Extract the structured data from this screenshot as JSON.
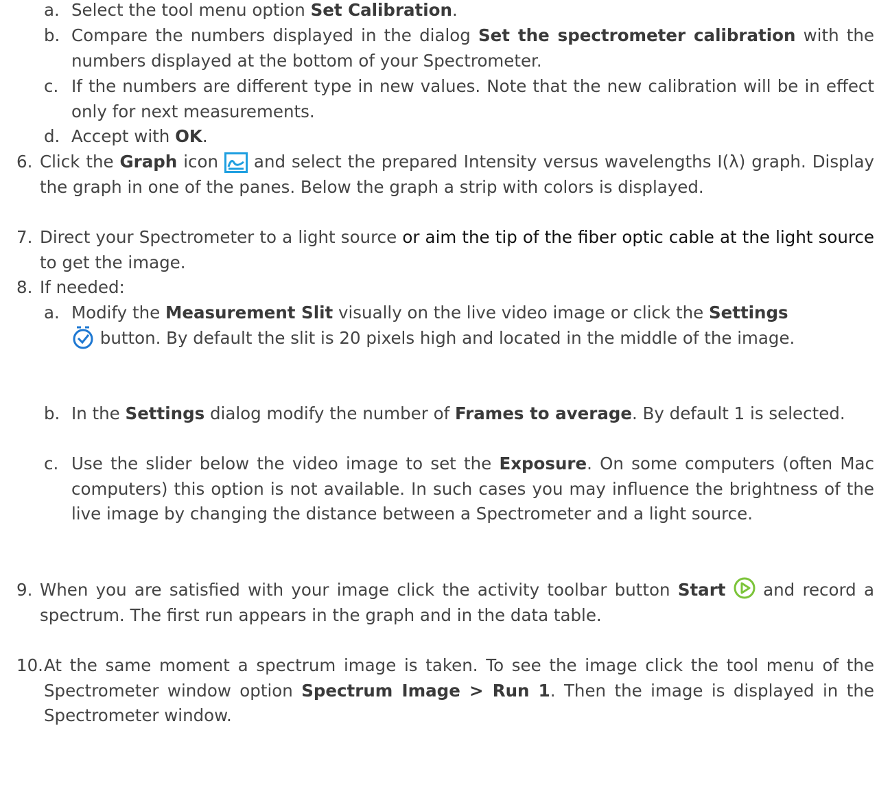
{
  "colors": {
    "text": "#444444",
    "graph_icon": "#1e9fe0",
    "settings_icon": "#1e78d2",
    "start_icon": "#7cc43a"
  },
  "steps": {
    "s5a": {
      "label": "a.",
      "t1": "Select the tool menu option ",
      "b1": "Set Calibration",
      "t2": "."
    },
    "s5b": {
      "label": "b.",
      "t1": "Compare the numbers displayed in the dialog ",
      "b1": "Set the spectrometer calibration",
      "t2": " with the numbers displayed at the bottom of your Spectrometer."
    },
    "s5c": {
      "label": "c.",
      "t1": "If the numbers are different type in new values. Note that the new calibration will be in effect only for next measurements."
    },
    "s5d": {
      "label": "d.",
      "t1": "Accept with ",
      "b1": "OK",
      "t2": "."
    },
    "s6": {
      "label": "6.",
      "t1": "Click the ",
      "b1": "Graph",
      "t2": " icon",
      "icon": "graph-icon",
      "t3": " and select the prepared Intensity versus wavelengths I(λ) graph. Display the graph in one of the panes. Below the graph a strip with colors is displayed."
    },
    "s7": {
      "label": "7.",
      "t1": "Direct your Spectrometer to a light source ",
      "t2": "or aim the tip of the fiber optic cable at the light source",
      "t3": " to get the image."
    },
    "s8": {
      "label": "8.",
      "t1": "If needed:"
    },
    "s8a": {
      "label": "a.",
      "t1": "Modify the ",
      "b1": "Measurement Slit",
      "t2": " visually on the live video image or click the ",
      "b2": "Settings",
      "icon": "stopwatch-icon",
      "t3": " button. By default the slit is 20 pixels high and located in the middle of the image."
    },
    "s8b": {
      "label": "b.",
      "t1": "In the ",
      "b1": "Settings",
      "t2": " dialog modify the number of ",
      "b2": "Frames to average",
      "t3": ". By default 1 is selected."
    },
    "s8c": {
      "label": "c.",
      "t1": "Use the slider below the video image to set the ",
      "b1": "Exposure",
      "t2": ". On some computers (often Mac computers) this option is not available. In such cases you may influence the brightness of the live image by changing the distance between a Spectrometer and a light source."
    },
    "s9": {
      "label": "9.",
      "t1": "When you are satisfied with your image click the activity toolbar button ",
      "b1": "Start",
      "icon": "play-icon",
      "t2": " and record a spectrum. The first run appears in the graph and in the data table."
    },
    "s10": {
      "label": "10.",
      "t1": "At the same moment a spectrum image is taken. To see the image click the tool menu of the Spectrometer window option ",
      "b1": "Spectrum Image > Run 1",
      "t2": ". Then the image is displayed in the Spectrometer window."
    }
  }
}
